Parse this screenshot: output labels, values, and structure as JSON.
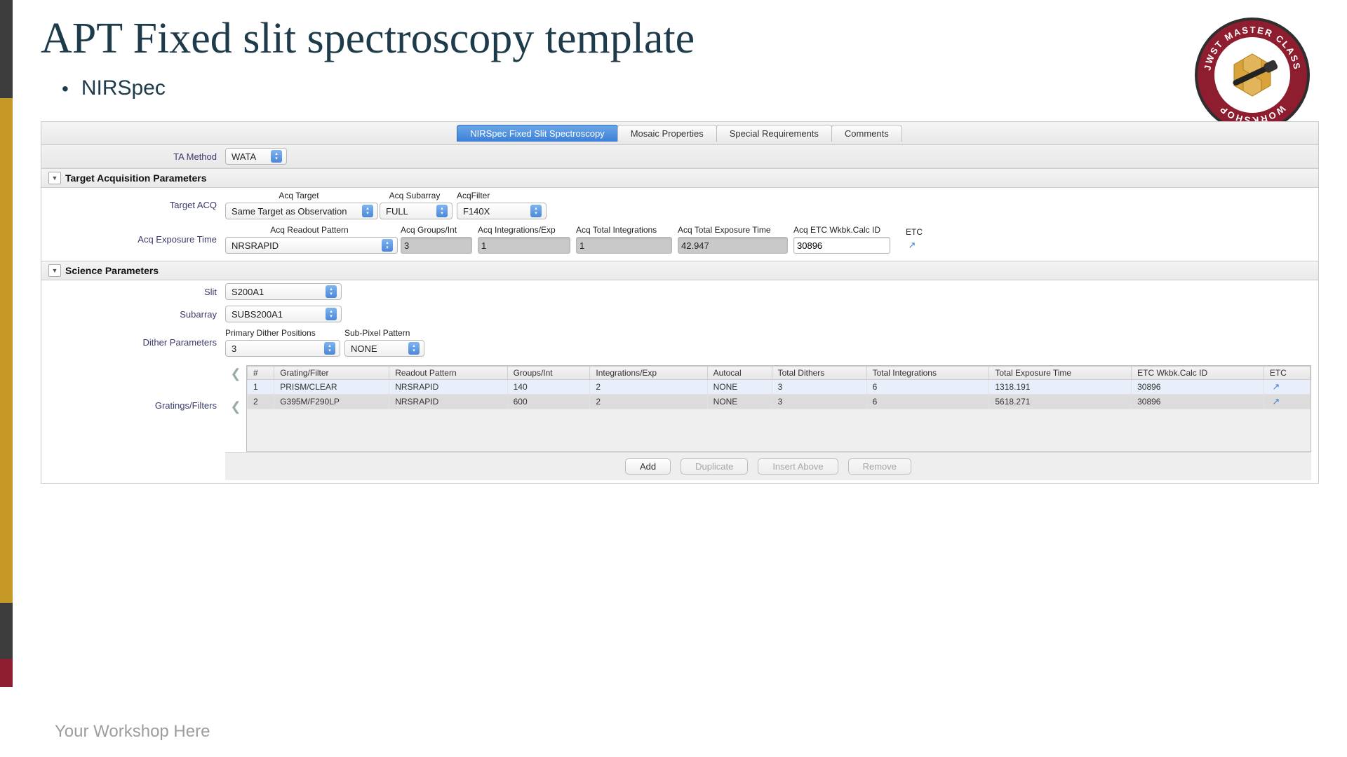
{
  "slide": {
    "title": "APT Fixed slit spectroscopy template",
    "bullet": "NIRSpec",
    "footer": "Your Workshop Here",
    "logo_text_top": "JWST MASTER CLASS",
    "logo_text_bottom": "WORKSHOP"
  },
  "tabs": {
    "active": "NIRSpec Fixed Slit Spectroscopy",
    "t2": "Mosaic Properties",
    "t3": "Special Requirements",
    "t4": "Comments"
  },
  "ta_method": {
    "label": "TA Method",
    "value": "WATA"
  },
  "sections": {
    "tap": "Target Acquisition Parameters",
    "sci": "Science Parameters"
  },
  "tap": {
    "row1_label": "Target ACQ",
    "acq_target_hdr": "Acq Target",
    "acq_target_val": "Same Target as Observation",
    "acq_subarray_hdr": "Acq Subarray",
    "acq_subarray_val": "FULL",
    "acq_filter_hdr": "AcqFilter",
    "acq_filter_val": "F140X",
    "row2_label": "Acq Exposure Time",
    "readout_hdr": "Acq Readout Pattern",
    "readout_val": "NRSRAPID",
    "groups_hdr": "Acq Groups/Int",
    "groups_val": "3",
    "intexp_hdr": "Acq Integrations/Exp",
    "intexp_val": "1",
    "totint_hdr": "Acq Total Integrations",
    "totint_val": "1",
    "totexp_hdr": "Acq Total Exposure Time",
    "totexp_val": "42.947",
    "calcid_hdr": "Acq ETC Wkbk.Calc ID",
    "calcid_val": "30896",
    "etc_hdr": "ETC"
  },
  "sci": {
    "slit_label": "Slit",
    "slit_val": "S200A1",
    "sub_label": "Subarray",
    "sub_val": "SUBS200A1",
    "dith_label": "Dither Parameters",
    "prim_hdr": "Primary Dither Positions",
    "prim_val": "3",
    "subpix_hdr": "Sub-Pixel Pattern",
    "subpix_val": "NONE",
    "grat_label": "Gratings/Filters"
  },
  "grid": {
    "headers": {
      "n": "#",
      "gf": "Grating/Filter",
      "rp": "Readout Pattern",
      "gi": "Groups/Int",
      "ie": "Integrations/Exp",
      "ac": "Autocal",
      "td": "Total Dithers",
      "ti": "Total Integrations",
      "tet": "Total Exposure Time",
      "wb": "ETC Wkbk.Calc ID",
      "etc": "ETC"
    },
    "rows": [
      {
        "n": "1",
        "gf": "PRISM/CLEAR",
        "rp": "NRSRAPID",
        "gi": "140",
        "ie": "2",
        "ac": "NONE",
        "td": "3",
        "ti": "6",
        "tet": "1318.191",
        "wb": "30896"
      },
      {
        "n": "2",
        "gf": "G395M/F290LP",
        "rp": "NRSRAPID",
        "gi": "600",
        "ie": "2",
        "ac": "NONE",
        "td": "3",
        "ti": "6",
        "tet": "5618.271",
        "wb": "30896"
      }
    ]
  },
  "buttons": {
    "add": "Add",
    "dup": "Duplicate",
    "ins": "Insert Above",
    "rem": "Remove"
  }
}
